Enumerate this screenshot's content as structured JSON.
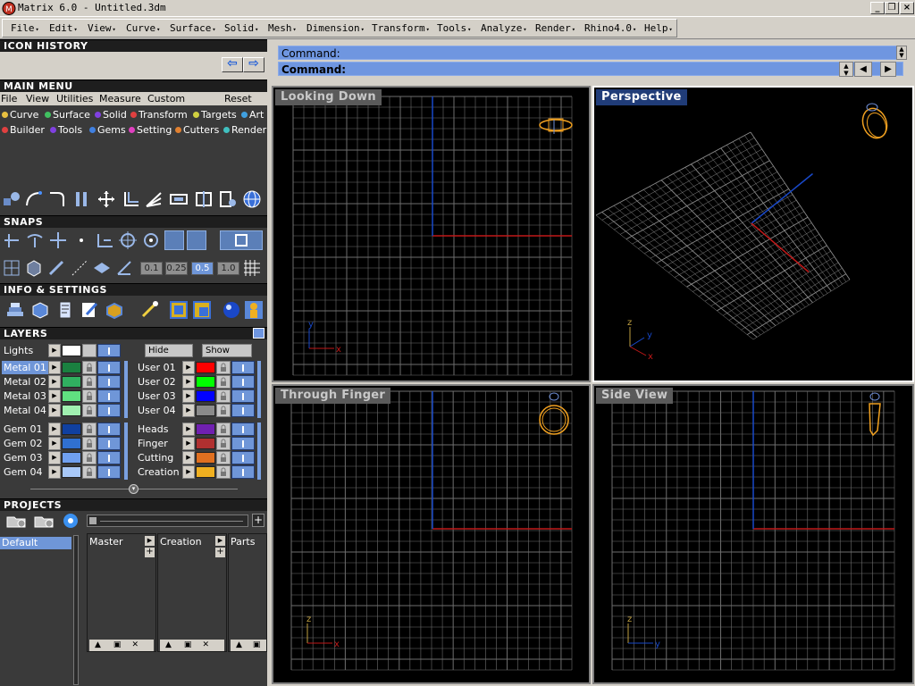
{
  "window": {
    "title": "Matrix 6.0 - Untitled.3dm",
    "controls": [
      "minimize",
      "restore",
      "close"
    ]
  },
  "menubar": [
    "File",
    "Edit",
    "View",
    "Curve",
    "Surface",
    "Solid",
    "Mesh",
    "Dimension",
    "Transform",
    "Tools",
    "Analyze",
    "Render",
    "Rhino4.0",
    "Help"
  ],
  "icon_history": {
    "title": "ICON HISTORY"
  },
  "main_menu": {
    "title": "MAIN MENU",
    "submenu": [
      "File",
      "View",
      "Utilities",
      "Measure",
      "Custom",
      "Reset"
    ],
    "categories_row1": [
      {
        "label": "Curve",
        "color": "#e8c040"
      },
      {
        "label": "Surface",
        "color": "#40c060"
      },
      {
        "label": "Solid",
        "color": "#8040e0"
      },
      {
        "label": "Transform",
        "color": "#e04040"
      },
      {
        "label": "Targets",
        "color": "#d0d040"
      },
      {
        "label": "Art",
        "color": "#40a0e0"
      }
    ],
    "categories_row2": [
      {
        "label": "Builder",
        "color": "#e04040"
      },
      {
        "label": "Tools",
        "color": "#8040e0"
      },
      {
        "label": "Gems",
        "color": "#4080e0"
      },
      {
        "label": "Setting",
        "color": "#e040c0"
      },
      {
        "label": "Cutters",
        "color": "#e08030"
      },
      {
        "label": "Render",
        "color": "#40c0c0"
      }
    ]
  },
  "snaps": {
    "title": "SNAPS",
    "values": [
      "0.1",
      "0.25",
      "0.5",
      "1.0"
    ]
  },
  "info_settings": {
    "title": "INFO & SETTINGS"
  },
  "layers": {
    "title": "LAYERS",
    "lights": "Lights",
    "hide": "Hide",
    "show": "Show",
    "left": [
      {
        "name": "Metal 01",
        "color": "#1a8040",
        "selected": true
      },
      {
        "name": "Metal 02",
        "color": "#30b060"
      },
      {
        "name": "Metal 03",
        "color": "#60e080"
      },
      {
        "name": "Metal 04",
        "color": "#a0f0b0"
      },
      {
        "name": "Gem 01",
        "color": "#1040a0"
      },
      {
        "name": "Gem 02",
        "color": "#3070d0"
      },
      {
        "name": "Gem 03",
        "color": "#70a0f0"
      },
      {
        "name": "Gem 04",
        "color": "#a8c8f8"
      }
    ],
    "right": [
      {
        "name": "User 01",
        "color": "#ff0000"
      },
      {
        "name": "User 02",
        "color": "#00ff00"
      },
      {
        "name": "User 03",
        "color": "#0000ff"
      },
      {
        "name": "User 04",
        "color": "#8a8a8a"
      },
      {
        "name": "Heads",
        "color": "#7020b0"
      },
      {
        "name": "Finger",
        "color": "#b03030"
      },
      {
        "name": "Cutting",
        "color": "#e07020"
      },
      {
        "name": "Creation",
        "color": "#f0b020"
      }
    ]
  },
  "projects": {
    "title": "PROJECTS",
    "list": [
      "Default"
    ],
    "columns": [
      "Master",
      "Creation",
      "Parts"
    ]
  },
  "command": {
    "line1": "Command:",
    "line2": "Command:"
  },
  "viewports": [
    {
      "name": "Looking Down",
      "active": false
    },
    {
      "name": "Perspective",
      "active": true
    },
    {
      "name": "Through Finger",
      "active": false
    },
    {
      "name": "Side View",
      "active": false
    }
  ],
  "axis_labels": {
    "x": "x",
    "y": "y",
    "z": "z"
  },
  "colors": {
    "grid": "#6e6e6e",
    "x_axis": "#c01818",
    "y_axis": "#1848c8",
    "object": "#f0a020"
  }
}
